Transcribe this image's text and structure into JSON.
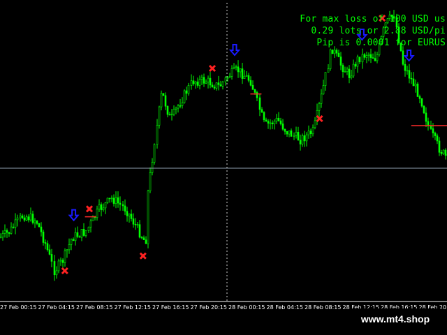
{
  "info": {
    "line1": "For max loss of 100 USD us",
    "line2": "0.29 lots or 2.88 USD/pi",
    "line3": "Pip is 0.0001 for EURUS"
  },
  "watermark": "www.mt4.shop",
  "colors": {
    "background": "#000000",
    "candle": "#00ff00",
    "info_text": "#00ff00",
    "cross_marker": "#ff2222",
    "arrow_marker": "#1a1aff",
    "level_line": "#ff2a2a",
    "crosshair": "#8f9fb0"
  },
  "chart_data": {
    "type": "candlestick",
    "x_tick_labels": [
      "27 Feb 00:15",
      "27 Feb 04:15",
      "27 Feb 08:15",
      "27 Feb 12:15",
      "27 Feb 16:15",
      "27 Feb 20:15",
      "28 Feb 00:15",
      "28 Feb 04:15",
      "28 Feb 08:15",
      "28 Feb 12:15",
      "28 Feb 16:15",
      "28 Feb 20"
    ],
    "price_path_relative": [
      [
        0,
        0.2
      ],
      [
        0.02,
        0.22
      ],
      [
        0.05,
        0.28
      ],
      [
        0.08,
        0.26
      ],
      [
        0.1,
        0.18
      ],
      [
        0.12,
        0.08
      ],
      [
        0.14,
        0.12
      ],
      [
        0.16,
        0.2
      ],
      [
        0.19,
        0.22
      ],
      [
        0.22,
        0.3
      ],
      [
        0.25,
        0.34
      ],
      [
        0.28,
        0.3
      ],
      [
        0.31,
        0.22
      ],
      [
        0.325,
        0.18
      ],
      [
        0.33,
        0.36
      ],
      [
        0.345,
        0.55
      ],
      [
        0.36,
        0.72
      ],
      [
        0.38,
        0.62
      ],
      [
        0.4,
        0.68
      ],
      [
        0.43,
        0.76
      ],
      [
        0.46,
        0.76
      ],
      [
        0.49,
        0.74
      ],
      [
        0.51,
        0.78
      ],
      [
        0.53,
        0.8
      ],
      [
        0.56,
        0.76
      ],
      [
        0.59,
        0.6
      ],
      [
        0.62,
        0.62
      ],
      [
        0.64,
        0.58
      ],
      [
        0.67,
        0.55
      ],
      [
        0.7,
        0.58
      ],
      [
        0.72,
        0.72
      ],
      [
        0.74,
        0.88
      ],
      [
        0.76,
        0.82
      ],
      [
        0.78,
        0.78
      ],
      [
        0.8,
        0.84
      ],
      [
        0.82,
        0.86
      ],
      [
        0.84,
        0.84
      ],
      [
        0.86,
        0.96
      ],
      [
        0.88,
        1.0
      ],
      [
        0.9,
        0.82
      ],
      [
        0.92,
        0.76
      ],
      [
        0.94,
        0.7
      ],
      [
        0.96,
        0.58
      ],
      [
        0.98,
        0.52
      ],
      [
        1.0,
        0.48
      ]
    ],
    "cross_markers_at": [
      0.145,
      0.2,
      0.32,
      0.475,
      0.715,
      0.855
    ],
    "arrow_markers_at": [
      0.165,
      0.525,
      0.81,
      0.915
    ]
  }
}
